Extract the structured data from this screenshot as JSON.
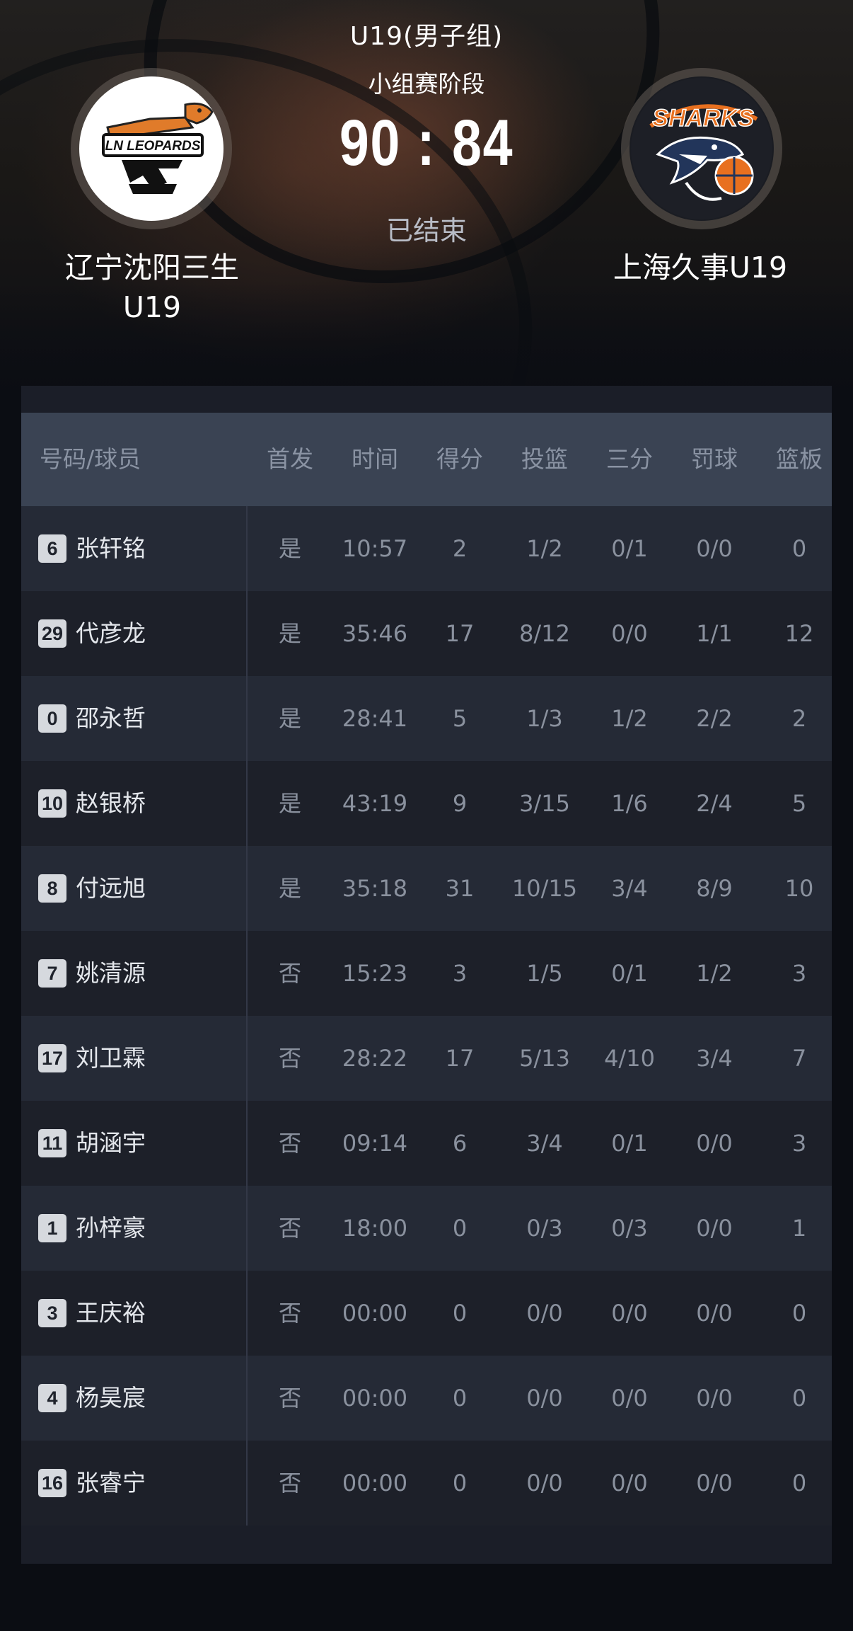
{
  "header": {
    "league": "U19(男子组)",
    "stage": "小组赛阶段",
    "score": "90 : 84",
    "status": "已结束",
    "home_team": {
      "name_line1": "辽宁沈阳三生",
      "name_line2": "U19",
      "logo": "leopards-logo",
      "logo_text": "LN LEOPARDS"
    },
    "away_team": {
      "name": "上海久事U19",
      "logo": "sharks-logo",
      "logo_text": "SHARKS"
    }
  },
  "table": {
    "headers": [
      "号码/球员",
      "首发",
      "时间",
      "得分",
      "投篮",
      "三分",
      "罚球",
      "篮板"
    ],
    "rows": [
      {
        "number": "6",
        "name": "张轩铭",
        "starter": "是",
        "time": "10:57",
        "points": "2",
        "fg": "1/2",
        "three": "0/1",
        "ft": "0/0",
        "reb": "0"
      },
      {
        "number": "29",
        "name": "代彦龙",
        "starter": "是",
        "time": "35:46",
        "points": "17",
        "fg": "8/12",
        "three": "0/0",
        "ft": "1/1",
        "reb": "12"
      },
      {
        "number": "0",
        "name": "邵永哲",
        "starter": "是",
        "time": "28:41",
        "points": "5",
        "fg": "1/3",
        "three": "1/2",
        "ft": "2/2",
        "reb": "2"
      },
      {
        "number": "10",
        "name": "赵银桥",
        "starter": "是",
        "time": "43:19",
        "points": "9",
        "fg": "3/15",
        "three": "1/6",
        "ft": "2/4",
        "reb": "5"
      },
      {
        "number": "8",
        "name": "付远旭",
        "starter": "是",
        "time": "35:18",
        "points": "31",
        "fg": "10/15",
        "three": "3/4",
        "ft": "8/9",
        "reb": "10"
      },
      {
        "number": "7",
        "name": "姚清源",
        "starter": "否",
        "time": "15:23",
        "points": "3",
        "fg": "1/5",
        "three": "0/1",
        "ft": "1/2",
        "reb": "3"
      },
      {
        "number": "17",
        "name": "刘卫霖",
        "starter": "否",
        "time": "28:22",
        "points": "17",
        "fg": "5/13",
        "three": "4/10",
        "ft": "3/4",
        "reb": "7"
      },
      {
        "number": "11",
        "name": "胡涵宇",
        "starter": "否",
        "time": "09:14",
        "points": "6",
        "fg": "3/4",
        "three": "0/1",
        "ft": "0/0",
        "reb": "3"
      },
      {
        "number": "1",
        "name": "孙梓豪",
        "starter": "否",
        "time": "18:00",
        "points": "0",
        "fg": "0/3",
        "three": "0/3",
        "ft": "0/0",
        "reb": "1"
      },
      {
        "number": "3",
        "name": "王庆裕",
        "starter": "否",
        "time": "00:00",
        "points": "0",
        "fg": "0/0",
        "three": "0/0",
        "ft": "0/0",
        "reb": "0"
      },
      {
        "number": "4",
        "name": "杨昊宸",
        "starter": "否",
        "time": "00:00",
        "points": "0",
        "fg": "0/0",
        "three": "0/0",
        "ft": "0/0",
        "reb": "0"
      },
      {
        "number": "16",
        "name": "张睿宁",
        "starter": "否",
        "time": "00:00",
        "points": "0",
        "fg": "0/0",
        "three": "0/0",
        "ft": "0/0",
        "reb": "0"
      }
    ]
  },
  "colors": {
    "background": "#0b0d13",
    "table_header_bg": "#3a4353",
    "row_light": "#252a36",
    "row_dark": "#1d2029",
    "muted_text": "#8a919e",
    "leopards_orange": "#e07b2a",
    "sharks_orange": "#e8701f",
    "sharks_navy": "#22355a"
  }
}
